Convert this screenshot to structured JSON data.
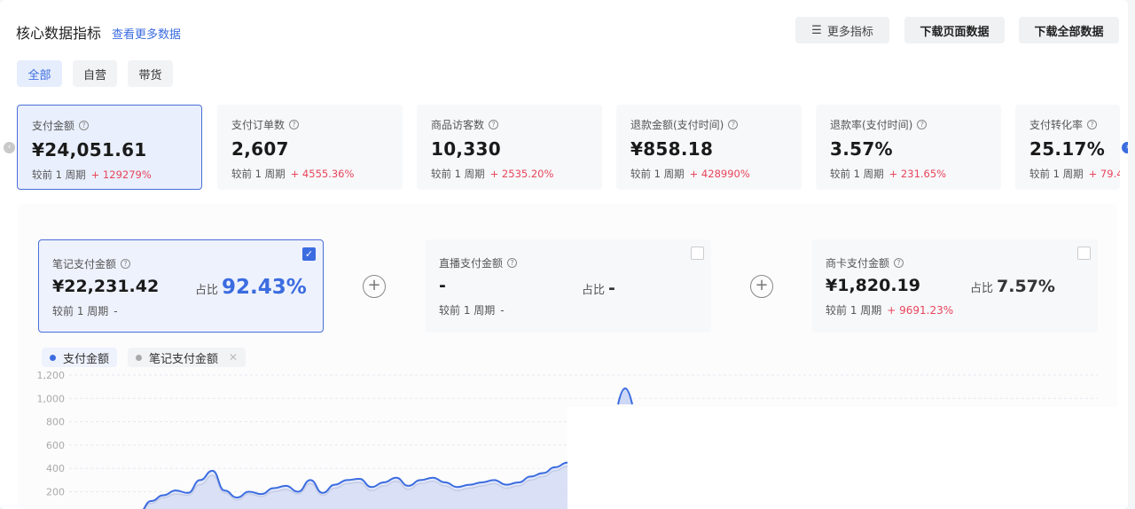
{
  "header": {
    "title": "核心数据指标",
    "more_link": "查看更多数据"
  },
  "toolbar": {
    "more_metrics": "更多指标",
    "download_page": "下载页面数据",
    "download_all": "下载全部数据",
    "more_icon": "sliders-icon"
  },
  "segments": [
    {
      "label": "全部",
      "active": true
    },
    {
      "label": "自营",
      "active": false
    },
    {
      "label": "带货",
      "active": false
    }
  ],
  "metrics": [
    {
      "label": "支付金额",
      "value": "¥24,051.61",
      "compare_label": "较前 1 周期",
      "change": "+ 129279%",
      "active": true
    },
    {
      "label": "支付订单数",
      "value": "2,607",
      "compare_label": "较前 1 周期",
      "change": "+ 4555.36%"
    },
    {
      "label": "商品访客数",
      "value": "10,330",
      "compare_label": "较前 1 周期",
      "change": "+ 2535.20%"
    },
    {
      "label": "退款金额(支付时间)",
      "value": "¥858.18",
      "compare_label": "较前 1 周期",
      "change": "+ 428990%"
    },
    {
      "label": "退款率(支付时间)",
      "value": "3.57%",
      "compare_label": "较前 1 周期",
      "change": "+ 231.65%"
    },
    {
      "label": "支付转化率",
      "value": "25.17%",
      "compare_label": "较前 1 周期",
      "change": "+ 79.4"
    }
  ],
  "breakdown": [
    {
      "label": "笔记支付金额",
      "value": "¥22,231.42",
      "share_label": "占比",
      "share": "92.43%",
      "compare_label": "较前 1 周期",
      "change": "-",
      "checked": true
    },
    {
      "label": "直播支付金额",
      "value": "-",
      "share_label": "占比",
      "share": "-",
      "compare_label": "较前 1 周期",
      "change": "-",
      "checked": false
    },
    {
      "label": "商卡支付金额",
      "value": "¥1,820.19",
      "share_label": "占比",
      "share": "7.57%",
      "compare_label": "较前 1 周期",
      "change": "+ 9691.23%",
      "checked": false
    }
  ],
  "legend": [
    {
      "label": "支付金额",
      "color": "#3b6ce0"
    },
    {
      "label": "笔记支付金额",
      "color": "#aaaaaa"
    }
  ],
  "colors": {
    "accent": "#3b6ce0",
    "up": "#e8455b"
  },
  "chart_data": {
    "type": "area",
    "y_ticks": [
      "1,200",
      "1,000",
      "800",
      "600",
      "400",
      "200"
    ],
    "ylim": [
      0,
      1200
    ],
    "grid": true,
    "series": [
      {
        "name": "支付金额",
        "values": [
          0,
          0,
          0,
          0,
          0,
          0,
          0,
          20,
          120,
          170,
          210,
          190,
          300,
          380,
          210,
          150,
          200,
          180,
          230,
          250,
          200,
          300,
          190,
          260,
          300,
          310,
          240,
          280,
          320,
          250,
          300,
          320,
          280,
          240,
          260,
          280,
          300,
          260,
          280,
          330,
          360,
          410,
          450
        ]
      },
      {
        "name": "笔记支付金额",
        "values": [
          0,
          0,
          0,
          0,
          0,
          0,
          0,
          10,
          100,
          150,
          180,
          170,
          260,
          340,
          190,
          130,
          180,
          160,
          200,
          220,
          180,
          270,
          170,
          230,
          270,
          280,
          210,
          250,
          290,
          220,
          270,
          290,
          250,
          210,
          230,
          250,
          270,
          230,
          250,
          300,
          330,
          380,
          420
        ]
      }
    ]
  }
}
